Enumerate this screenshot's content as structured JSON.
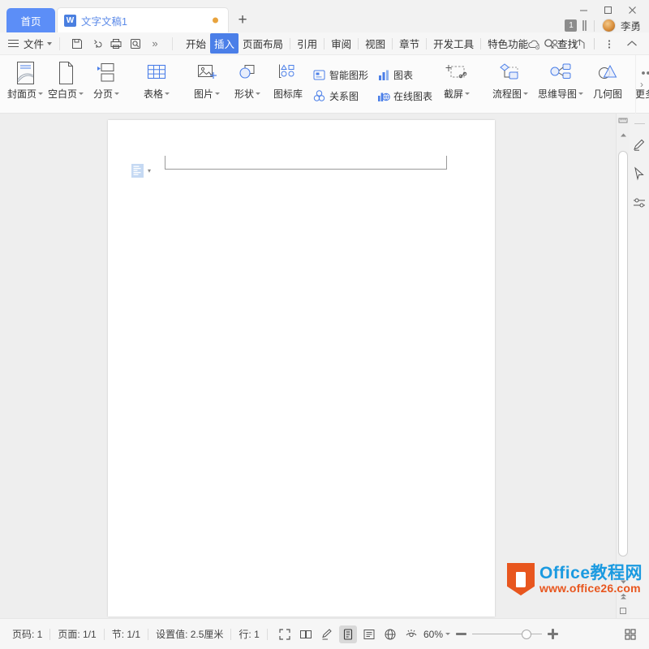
{
  "titlebar": {
    "home_tab": "首页",
    "doc_tab": "文字文稿1",
    "doc_icon": "wps-writer-icon",
    "add_tab": "+",
    "minimize": "—",
    "maximize": "▢",
    "close": "✕",
    "notify_count": "1",
    "user_name": "李勇"
  },
  "menubar": {
    "file": "文件",
    "quick_icons": [
      "save-icon",
      "undo-icon",
      "print-icon",
      "print-preview-icon",
      "more-quick-icon"
    ],
    "more": "»",
    "tabs": [
      {
        "label": "开始",
        "active": false
      },
      {
        "label": "插入",
        "active": true
      },
      {
        "label": "页面布局",
        "active": false
      },
      {
        "label": "引用",
        "active": false
      },
      {
        "label": "审阅",
        "active": false
      },
      {
        "label": "视图",
        "active": false
      },
      {
        "label": "章节",
        "active": false
      },
      {
        "label": "开发工具",
        "active": false
      },
      {
        "label": "特色功能",
        "active": false
      }
    ],
    "find": "查找",
    "right_icons": [
      "cloud-sync-icon",
      "add-collaborator-icon",
      "share-icon",
      "more-options-icon",
      "collapse-ribbon-icon"
    ]
  },
  "ribbon": {
    "groups": [
      {
        "buttons": [
          {
            "label": "封面页",
            "icon": "cover-page-icon",
            "dropdown": true
          },
          {
            "label": "空白页",
            "icon": "blank-page-icon",
            "dropdown": true
          },
          {
            "label": "分页",
            "icon": "page-break-icon",
            "dropdown": true
          }
        ]
      },
      {
        "buttons": [
          {
            "label": "表格",
            "icon": "table-icon",
            "dropdown": true
          }
        ]
      },
      {
        "buttons": [
          {
            "label": "图片",
            "icon": "picture-icon",
            "dropdown": true
          },
          {
            "label": "形状",
            "icon": "shapes-icon",
            "dropdown": true
          },
          {
            "label": "图标库",
            "icon": "icon-library-icon",
            "dropdown": false
          }
        ]
      },
      {
        "small_buttons": [
          {
            "label": "智能图形",
            "icon": "smart-art-icon"
          },
          {
            "label": "关系图",
            "icon": "relation-chart-icon"
          },
          {
            "label": "图表",
            "icon": "chart-icon"
          },
          {
            "label": "在线图表",
            "icon": "online-chart-icon"
          }
        ],
        "buttons": [
          {
            "label": "截屏",
            "icon": "screenshot-icon",
            "dropdown": true
          }
        ]
      },
      {
        "buttons": [
          {
            "label": "流程图",
            "icon": "flowchart-icon",
            "dropdown": true
          },
          {
            "label": "思维导图",
            "icon": "mindmap-icon",
            "dropdown": true
          },
          {
            "label": "几何图",
            "icon": "geometry-icon",
            "dropdown": false
          },
          {
            "label": "更多",
            "icon": "more-dots-icon",
            "dropdown": true
          }
        ]
      }
    ],
    "scroll_right": "›"
  },
  "document": {
    "paragraph_icon": "layout-options-icon",
    "paragraph_caret": "▾"
  },
  "rail": {
    "icons": [
      "highlighter-pen-icon",
      "select-cursor-icon",
      "settings-sliders-icon"
    ]
  },
  "scrollbar": {
    "top_icon": "ruler-icon",
    "up_arrow": "▲",
    "down_arrow": "▼",
    "prev_page": "▲",
    "select_object": "▢"
  },
  "statusbar": {
    "items": [
      "页码: 1",
      "页面: 1/1",
      "节: 1/1",
      "设置值: 2.5厘米",
      "行: 1"
    ],
    "view_icons": [
      {
        "name": "fullscreen-icon",
        "selected": false
      },
      {
        "name": "two-page-view-icon",
        "selected": false
      },
      {
        "name": "edit-pen-icon",
        "selected": false
      },
      {
        "name": "page-view-icon",
        "selected": true
      },
      {
        "name": "outline-view-icon",
        "selected": false
      },
      {
        "name": "web-view-icon",
        "selected": false
      },
      {
        "name": "eye-protect-icon",
        "selected": false
      }
    ],
    "zoom_value": "60%",
    "zoom_caret": "▾",
    "grid_icon": "layout-grid-icon"
  },
  "watermark": {
    "title": "Office教程网",
    "url": "www.office26.com"
  },
  "colors": {
    "accent_blue": "#4b7fe8",
    "home_tab_blue": "#5c8ef7",
    "doc_tab_text": "#5b8ae8",
    "tab_dot_orange": "#e8a33d",
    "watermark_blue": "#1b9ae0",
    "watermark_orange": "#e8561e",
    "workspace_gray": "#eeeeee"
  }
}
